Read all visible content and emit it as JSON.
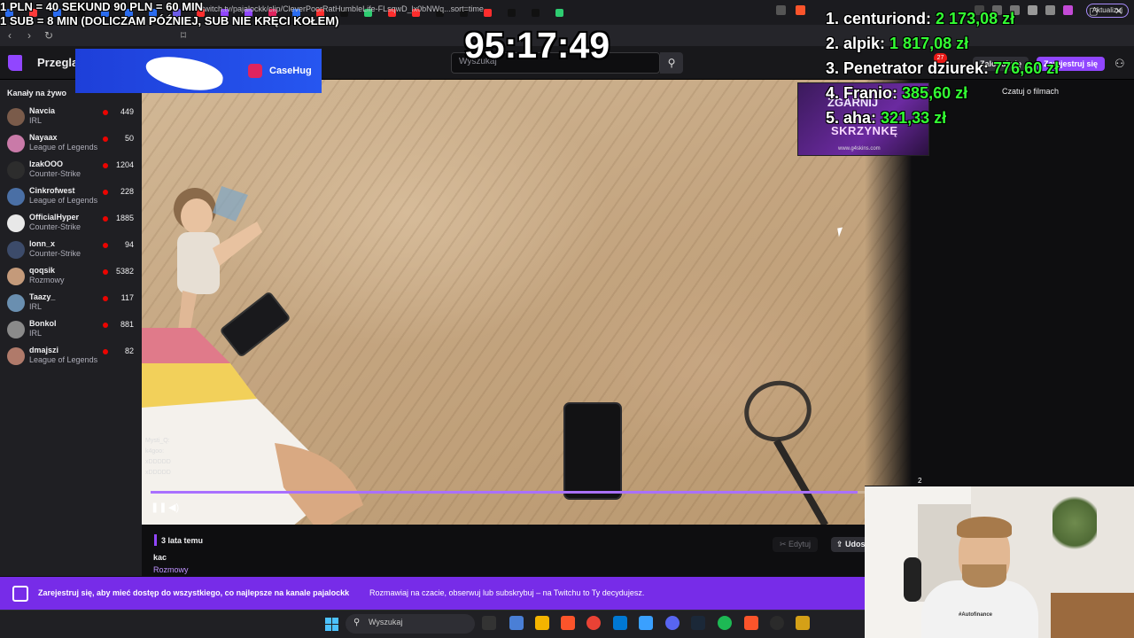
{
  "browser": {
    "url": "twitch.tv/pajalockk/clip/CleverPoorRatHumbleLife-FLsqwD_lx0bNWq...sort=time",
    "update_label": "Aktualizuj",
    "notification_count": "27"
  },
  "twitch": {
    "browse_label": "Przeglądaj",
    "search_placeholder": "Wyszukaj",
    "login_label": "Zaloguj się",
    "signup_label": "Zarejestruj się",
    "sidebar_title": "Kanały na żywo",
    "channels": [
      {
        "name": "Navcia",
        "category": "IRL",
        "viewers": "449",
        "color": "#7a5b4a"
      },
      {
        "name": "Nayaax",
        "category": "League of Legends",
        "viewers": "50",
        "color": "#c97aa8"
      },
      {
        "name": "IzakOOO",
        "category": "Counter-Strike",
        "viewers": "1204",
        "color": "#2d2d2d"
      },
      {
        "name": "Cinkrofwest",
        "category": "League of Legends",
        "viewers": "228",
        "color": "#4a6fa5"
      },
      {
        "name": "OfficialHyper",
        "category": "Counter-Strike",
        "viewers": "1885",
        "color": "#e8e8e8"
      },
      {
        "name": "lonn_x",
        "category": "Counter-Strike",
        "viewers": "94",
        "color": "#3c4b6a"
      },
      {
        "name": "qoqsik",
        "category": "Rozmowy",
        "viewers": "5382",
        "color": "#c49a7a"
      },
      {
        "name": "Taazy_",
        "category": "IRL",
        "viewers": "117",
        "color": "#6a8fb0"
      },
      {
        "name": "Bonkol",
        "category": "IRL",
        "viewers": "881",
        "color": "#8a8a8a"
      },
      {
        "name": "dmajszi",
        "category": "League of Legends",
        "viewers": "82",
        "color": "#b07a6a"
      }
    ],
    "watch_chat_label": "Czatuj o filmach",
    "clip": {
      "time_ago": "3 lata temu",
      "title": "kac",
      "category": "Rozmowy",
      "edit_label": "Edytuj",
      "share_label": "Udostępnij",
      "progress": 0.99
    },
    "chat_overlay": [
      "Mysti_Q:",
      "k4goo:",
      "xDDDDD",
      "xDDDDD"
    ],
    "banner": {
      "text_bold": "Zarejestruj się, aby mieć dostęp do wszystkiego, co najlepsze na kanale pajalockk",
      "text": "Rozmawiaj na czacie, obserwuj lub subskrybuj – na Twitchu to Ty decydujesz."
    },
    "player_counter": "2"
  },
  "overlay": {
    "rules_line1": "1 PLN =  40 SEKUND 90 PLN = 60 MIN",
    "rules_line2": "1 SUB = 8 MIN (DOLICZAM PÓŹNIEJ, SUB NIE KRĘCI KOŁEM)",
    "timer": "95:17:49",
    "sponsor": "CaseHug",
    "ad_line1": "ZGARNIJ",
    "ad_line2": "SKRZYNKĘ",
    "ad_site": "www.g4skins.com",
    "leaderboard": [
      {
        "name": "1. centuriond:",
        "amount": "2 173,08 zł"
      },
      {
        "name": "2. alpik:",
        "amount": "1 817,08 zł"
      },
      {
        "name": "3. Penetrator dziurek:",
        "amount": "776,60 zł"
      },
      {
        "name": "4. Franio:",
        "amount": "385,60 zł"
      },
      {
        "name": "5. aha:",
        "amount": "321,33 zł"
      }
    ]
  },
  "webcam": {
    "shirt_text": "#Autofinance"
  },
  "taskbar": {
    "search_placeholder": "Wyszukaj"
  }
}
